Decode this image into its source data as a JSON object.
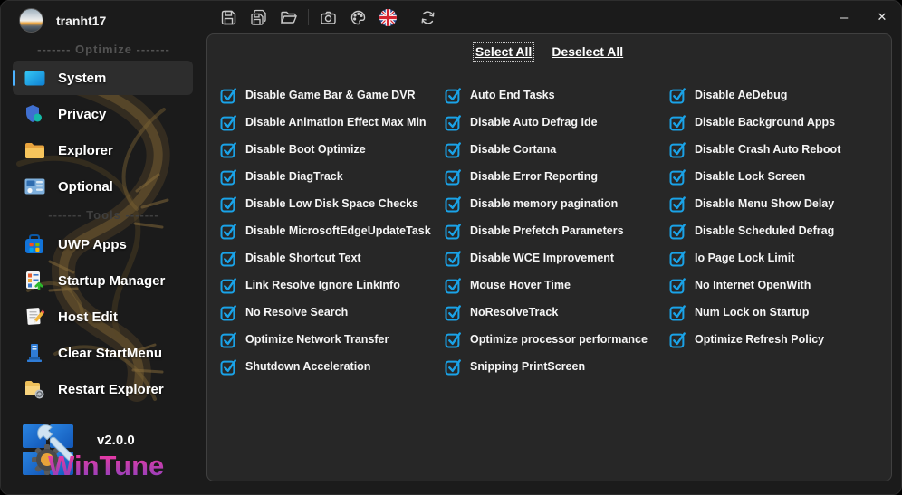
{
  "user": {
    "name": "tranht17"
  },
  "titlebar": {
    "minimize_glyph": "–",
    "close_glyph": "✕",
    "toolbar_icons": [
      "save",
      "save-copy",
      "open-folder",
      "screenshot-camera",
      "theme-palette",
      "language-uk-flag",
      "refresh"
    ]
  },
  "sidebar": {
    "optimize_separator": "-------  Optimize  -------",
    "tools_separator": "-------  Tools  -------",
    "items": [
      {
        "label": "System",
        "active": true
      },
      {
        "label": "Privacy",
        "active": false
      },
      {
        "label": "Explorer",
        "active": false
      },
      {
        "label": "Optional",
        "active": false
      },
      {
        "label": "UWP Apps",
        "active": false
      },
      {
        "label": "Startup Manager",
        "active": false
      },
      {
        "label": "Host Edit",
        "active": false
      },
      {
        "label": "Clear StartMenu",
        "active": false
      },
      {
        "label": "Restart Explorer",
        "active": false
      }
    ],
    "footer": {
      "version": "v2.0.0",
      "brand": "WinTune"
    }
  },
  "main": {
    "select_all_label": "Select All",
    "deselect_all_label": "Deselect All",
    "all_checked": true,
    "columns": [
      [
        "Disable Game Bar & Game DVR",
        "Disable Animation Effect Max Min",
        "Disable Boot Optimize",
        "Disable DiagTrack",
        "Disable Low Disk Space Checks",
        "Disable MicrosoftEdgeUpdateTask",
        "Disable Shortcut Text",
        "Link Resolve Ignore LinkInfo",
        "No Resolve Search",
        "Optimize Network Transfer",
        "Shutdown Acceleration"
      ],
      [
        "Auto End Tasks",
        "Disable Auto Defrag Ide",
        "Disable Cortana",
        "Disable Error Reporting",
        "Disable memory pagination",
        "Disable Prefetch Parameters",
        "Disable WCE Improvement",
        "Mouse Hover Time",
        "NoResolveTrack",
        "Optimize processor performance",
        "Snipping PrintScreen"
      ],
      [
        "Disable AeDebug",
        "Disable Background Apps",
        "Disable Crash Auto Reboot",
        "Disable Lock Screen",
        "Disable Menu Show Delay",
        "Disable Scheduled Defrag",
        "Io Page Lock Limit",
        "No Internet OpenWith",
        "Num Lock on Startup",
        "Optimize Refresh Policy"
      ]
    ]
  },
  "colors": {
    "checkbox_blue": "#1aa3e8",
    "sidebar_accent": "#4cb2ff",
    "panel_bg": "#272727",
    "window_bg": "#1b1b1b",
    "brand_gradient_top": "#ff37a0",
    "brand_gradient_bottom": "#8a3fc0"
  }
}
